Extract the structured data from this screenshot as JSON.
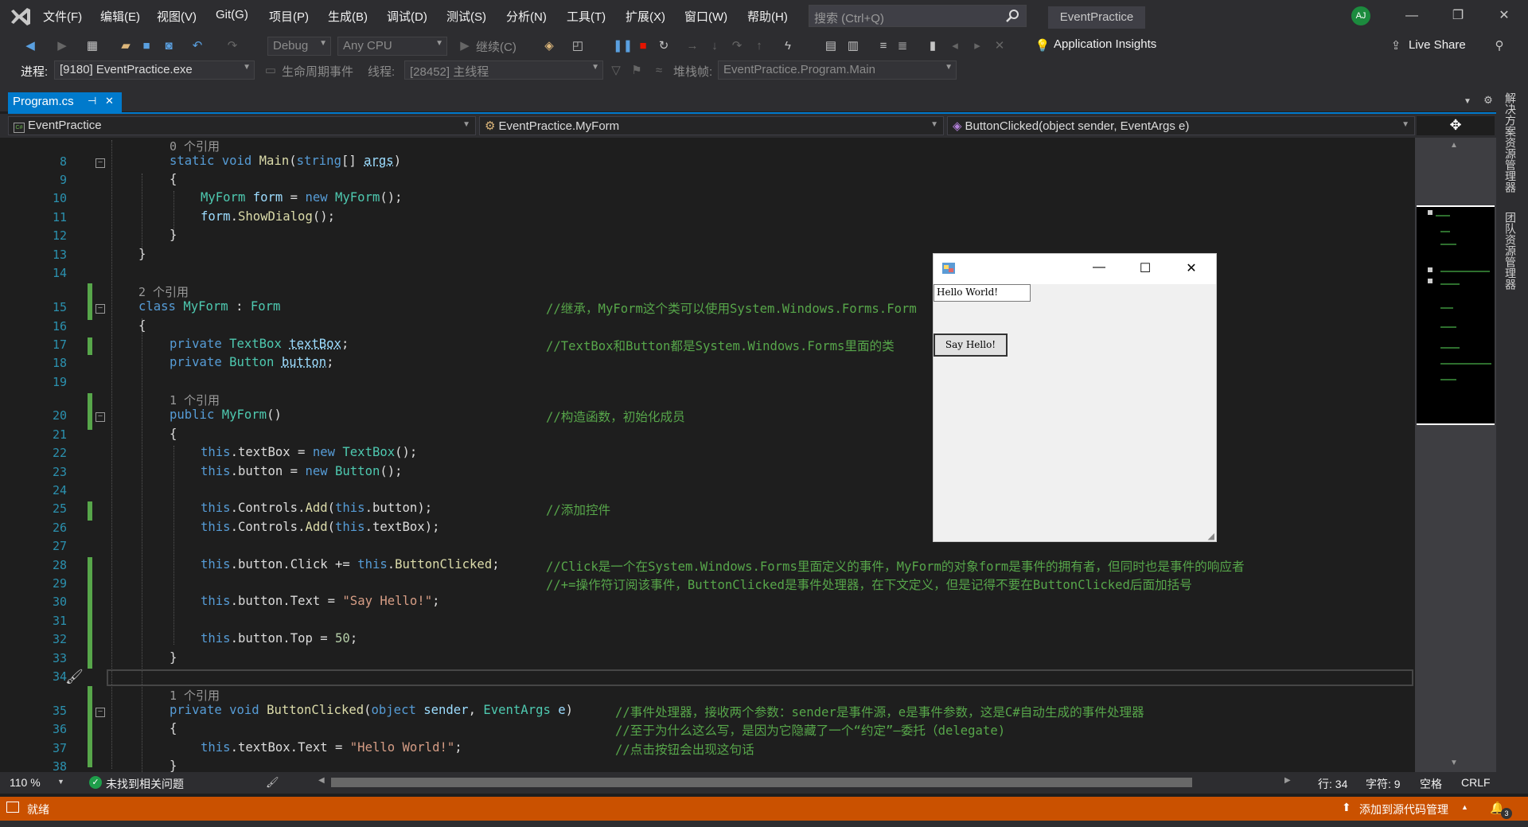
{
  "menu": [
    "文件(F)",
    "编辑(E)",
    "视图(V)",
    "Git(G)",
    "项目(P)",
    "生成(B)",
    "调试(D)",
    "测试(S)",
    "分析(N)",
    "工具(T)",
    "扩展(X)",
    "窗口(W)",
    "帮助(H)"
  ],
  "search": {
    "placeholder": "搜索 (Ctrl+Q)"
  },
  "solution_title": "EventPractice",
  "avatar": "AJ",
  "toolbar": {
    "config": "Debug",
    "platform": "Any CPU",
    "continue": "继续(C)",
    "app_insights": "Application Insights",
    "live_share": "Live Share"
  },
  "debugbar": {
    "process_label": "进程:",
    "process": "[9180] EventPractice.exe",
    "lifecycle": "生命周期事件",
    "thread_label": "线程:",
    "thread": "[28452] 主线程",
    "stack_label": "堆栈帧:",
    "stack": "EventPractice.Program.Main"
  },
  "tab": {
    "name": "Program.cs",
    "pin": "⊣",
    "close": "✕"
  },
  "nav": {
    "project": "EventPractice",
    "class": "EventPractice.MyForm",
    "member": "ButtonClicked(object sender, EventArgs e)",
    "project_badge": "C#"
  },
  "code": {
    "refs": {
      "r0": "0 个引用",
      "r2": "2 个引用",
      "r1a": "1 个引用",
      "r1b": "1 个引用"
    },
    "line_numbers": [
      "8",
      "9",
      "10",
      "11",
      "12",
      "13",
      "14",
      "15",
      "16",
      "17",
      "18",
      "19",
      "20",
      "21",
      "22",
      "23",
      "24",
      "25",
      "26",
      "27",
      "28",
      "29",
      "30",
      "31",
      "32",
      "33",
      "34",
      "35",
      "36",
      "37",
      "38"
    ],
    "comments": {
      "c15": "//继承，MyForm这个类可以使用System.Windows.Forms.Form",
      "c17": "//TextBox和Button都是System.Windows.Forms里面的类",
      "c20": "//构造函数，初始化成员",
      "c25": "//添加控件",
      "c28": "//Click是一个在System.Windows.Forms里面定义的事件，MyForm的对象form是事件的拥有者，但同时也是事件的响应者",
      "c29": "//+=操作符订阅该事件，ButtonClicked是事件处理器，在下文定义，但是记得不要在ButtonClicked后面加括号",
      "c35": "//事件处理器，接收两个参数：sender是事件源，e是事件参数，这是C#自动生成的事件处理器",
      "c36": "//至于为什么这么写，是因为它隐藏了一个“约定”—委托（delegate)",
      "c37": "//点击按钮会出现这句话"
    },
    "strings": {
      "s30": "\"Say Hello!\"",
      "s37": "\"Hello World!\""
    }
  },
  "form_window": {
    "textbox": "Hello World!",
    "button": "Say Hello!"
  },
  "status": {
    "zoom": "110 %",
    "issues": "未找到相关问题",
    "line": "行: 34",
    "char": "字符: 9",
    "spaces": "空格",
    "eol": "CRLF",
    "ready": "就绪",
    "source_control": "添加到源代码管理",
    "notifications": "3"
  },
  "right_tabs": [
    "解决方案资源管理器",
    "团队资源管理器"
  ],
  "colors": {
    "accent": "#007acc",
    "status_bar": "#ca5100",
    "comment": "#57a64a",
    "keyword": "#569cd6",
    "type": "#4ec9b0"
  }
}
